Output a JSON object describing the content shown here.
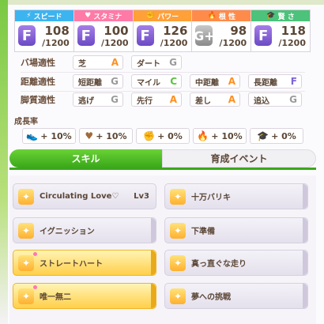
{
  "stats": [
    {
      "label": "スピード",
      "icon": "shoe-icon",
      "icon_glyph": "⚡",
      "grade": "F",
      "value": "108",
      "max": "/1200"
    },
    {
      "label": "スタミナ",
      "icon": "heart-icon",
      "icon_glyph": "♥",
      "grade": "F",
      "value": "100",
      "max": "/1200"
    },
    {
      "label": "パワー",
      "icon": "muscle-icon",
      "icon_glyph": "✊",
      "grade": "F",
      "value": "126",
      "max": "/1200"
    },
    {
      "label": "根 性",
      "icon": "flame-icon",
      "icon_glyph": "🔥",
      "grade": "G+",
      "value": "98",
      "max": "/1200"
    },
    {
      "label": "賢 さ",
      "icon": "graduation-cap-icon",
      "icon_glyph": "🎓",
      "grade": "F",
      "value": "118",
      "max": "/1200"
    }
  ],
  "aptitude": {
    "ground": {
      "label": "バ場適性",
      "items": [
        {
          "name": "芝",
          "level": "A"
        },
        {
          "name": "ダート",
          "level": "G"
        }
      ]
    },
    "distance": {
      "label": "距離適性",
      "items": [
        {
          "name": "短距離",
          "level": "G"
        },
        {
          "name": "マイル",
          "level": "C"
        },
        {
          "name": "中距離",
          "level": "A"
        },
        {
          "name": "長距離",
          "level": "F"
        }
      ]
    },
    "style": {
      "label": "脚質適性",
      "items": [
        {
          "name": "逃げ",
          "level": "G"
        },
        {
          "name": "先行",
          "level": "A"
        },
        {
          "name": "差し",
          "level": "A"
        },
        {
          "name": "追込",
          "level": "G"
        }
      ]
    }
  },
  "growth": {
    "title": "成長率",
    "items": [
      {
        "icon": "shoe-icon",
        "glyph": "👟",
        "value": "+ 10%"
      },
      {
        "icon": "heart-icon",
        "glyph": "♥",
        "value": "+ 10%"
      },
      {
        "icon": "muscle-icon",
        "glyph": "✊",
        "value": "+ 0%"
      },
      {
        "icon": "flame-icon",
        "glyph": "🔥",
        "value": "+ 10%"
      },
      {
        "icon": "graduation-cap-icon",
        "glyph": "🎓",
        "value": "+ 0%"
      }
    ]
  },
  "tabs": {
    "skill": "スキル",
    "event": "育成イベント"
  },
  "skills": [
    {
      "name": "Circulating Love♡",
      "level": "Lv3",
      "style": "plain"
    },
    {
      "name": "十万バリキ",
      "level": "",
      "style": "plain"
    },
    {
      "name": "イグニッション",
      "level": "",
      "style": "plain"
    },
    {
      "name": "下準備",
      "level": "",
      "style": "plain"
    },
    {
      "name": "ストレートハート",
      "level": "",
      "style": "gold"
    },
    {
      "name": "真っ直ぐな走り",
      "level": "",
      "style": "plain"
    },
    {
      "name": "唯一無二",
      "level": "",
      "style": "gold"
    },
    {
      "name": "夢への挑戦",
      "level": "",
      "style": "plain"
    }
  ]
}
